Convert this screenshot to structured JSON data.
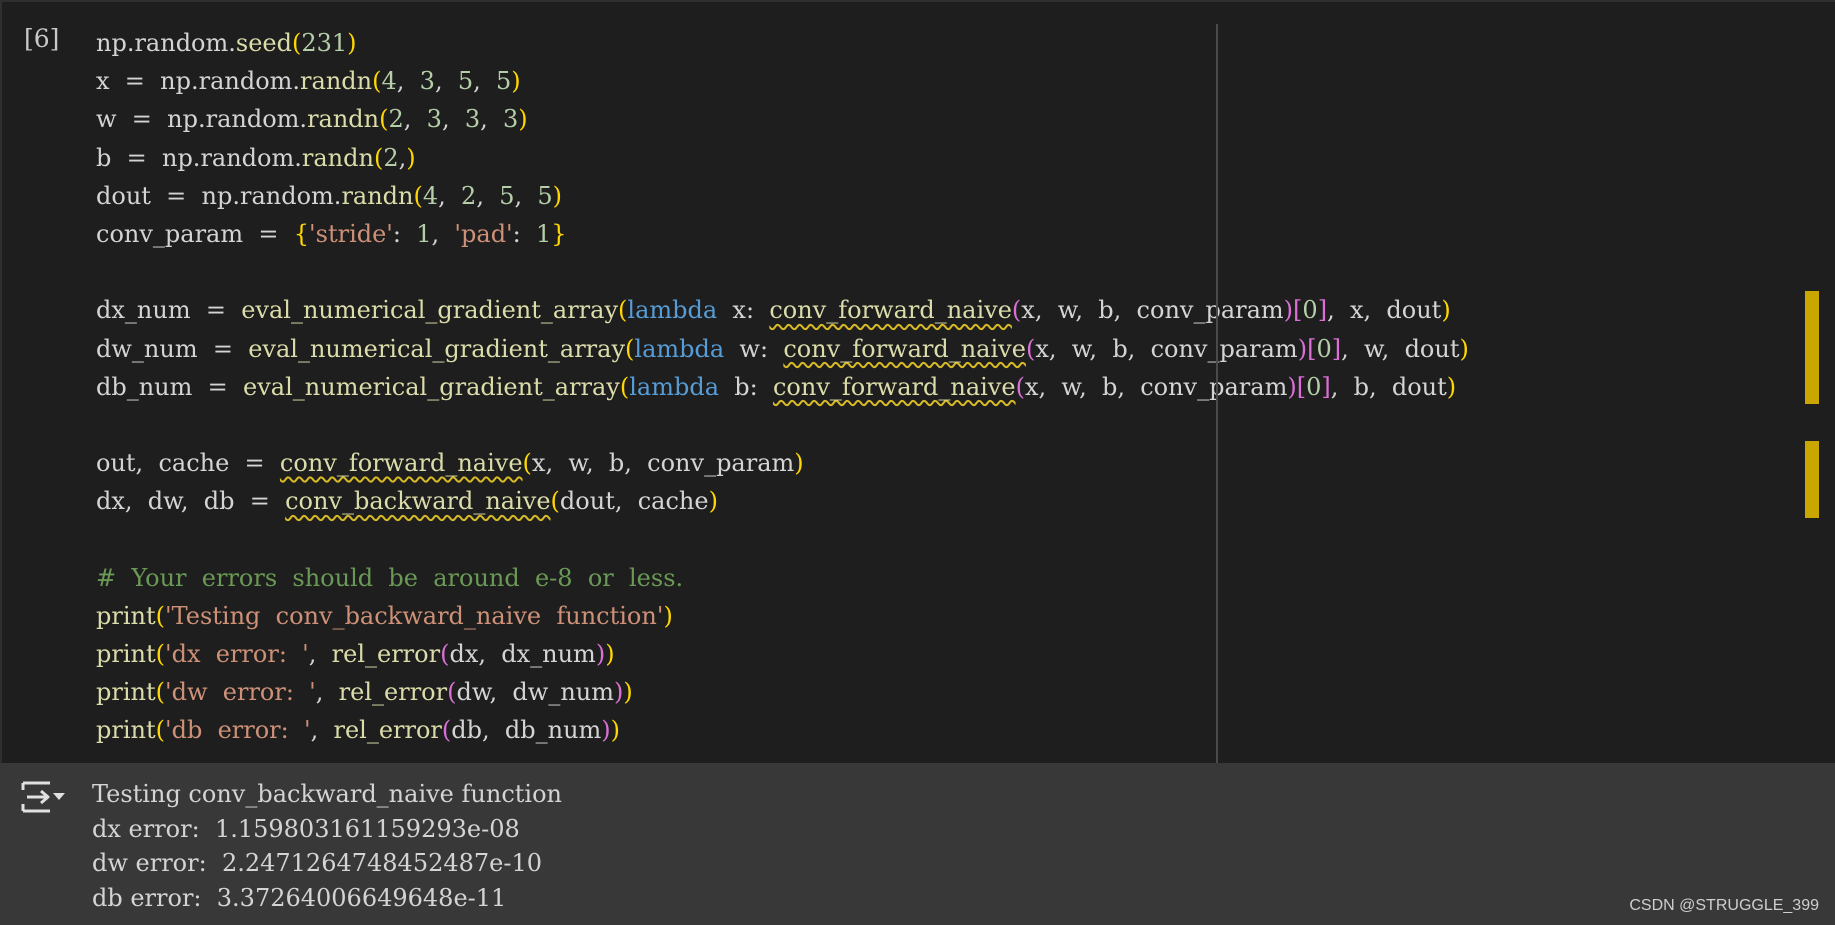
{
  "cell": {
    "execution_count": "[6]",
    "code_lines": [
      "np.random.seed(231)",
      "x  =  np.random.randn(4,  3,  5,  5)",
      "w  =  np.random.randn(2,  3,  3,  3)",
      "b  =  np.random.randn(2,)",
      "dout  =  np.random.randn(4,  2,  5,  5)",
      "conv_param  =  {'stride':  1,  'pad':  1}",
      "",
      "dx_num  =  eval_numerical_gradient_array(lambda  x:  conv_forward_naive(x,  w,  b,  conv_param)[0],  x,  dout)",
      "dw_num  =  eval_numerical_gradient_array(lambda  w:  conv_forward_naive(x,  w,  b,  conv_param)[0],  w,  dout)",
      "db_num  =  eval_numerical_gradient_array(lambda  b:  conv_forward_naive(x,  w,  b,  conv_param)[0],  b,  dout)",
      "",
      "out,  cache  =  conv_forward_naive(x,  w,  b,  conv_param)",
      "dx,  dw,  db  =  conv_backward_naive(dout,  cache)",
      "",
      "#  Your  errors  should  be  around  e-8  or  less.",
      "print('Testing  conv_backward_naive  function')",
      "print('dx  error:  ',  rel_error(dx,  dx_num))",
      "print('dw  error:  ',  rel_error(dw,  dw_num))",
      "print('db  error:  ',  rel_error(db,  db_num))"
    ]
  },
  "output": {
    "icon": "output-toggle-icon",
    "lines": [
      "Testing conv_backward_naive function",
      "dx error:  1.159803161159293e-08",
      "dw error:  2.2471264748452487e-10",
      "db error:  3.37264006649648e-11"
    ]
  },
  "watermark": "CSDN @STRUGGLE_399",
  "colors": {
    "editor_bg": "#1e1e1e",
    "output_bg": "#383838",
    "keyword": "#569cd6",
    "number": "#b5cea8",
    "string": "#ce9178",
    "comment": "#6a9955",
    "function": "#dcdcaa",
    "marker": "#c9a700"
  }
}
